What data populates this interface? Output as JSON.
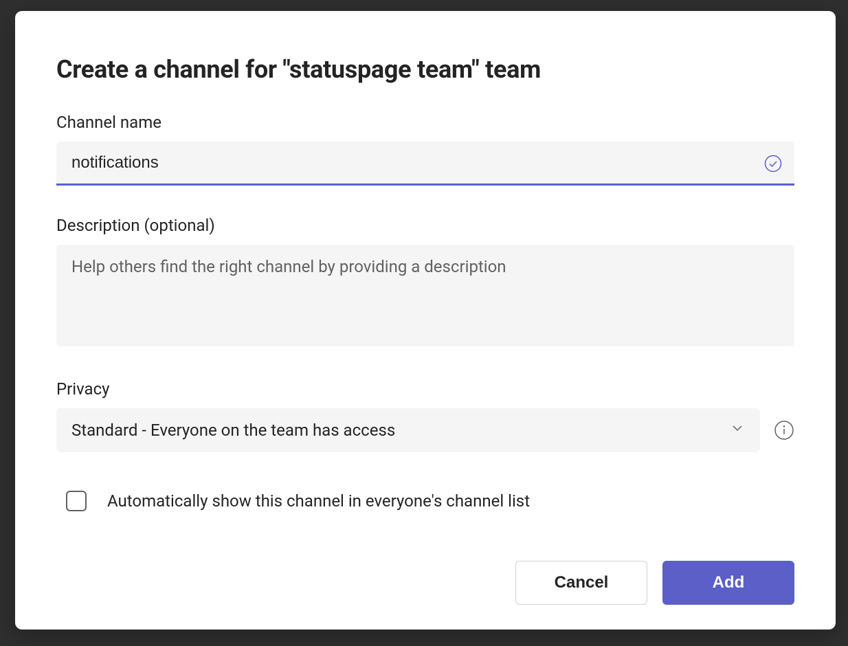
{
  "modal": {
    "title": "Create a channel for \"statuspage team\" team",
    "channelName": {
      "label": "Channel name",
      "value": "notifications"
    },
    "description": {
      "label": "Description (optional)",
      "value": "",
      "placeholder": "Help others find the right channel by providing a description"
    },
    "privacy": {
      "label": "Privacy",
      "selected": "Standard - Everyone on the team has access"
    },
    "autoShow": {
      "label": "Automatically show this channel in everyone's channel list",
      "checked": false
    },
    "buttons": {
      "cancel": "Cancel",
      "add": "Add"
    }
  }
}
